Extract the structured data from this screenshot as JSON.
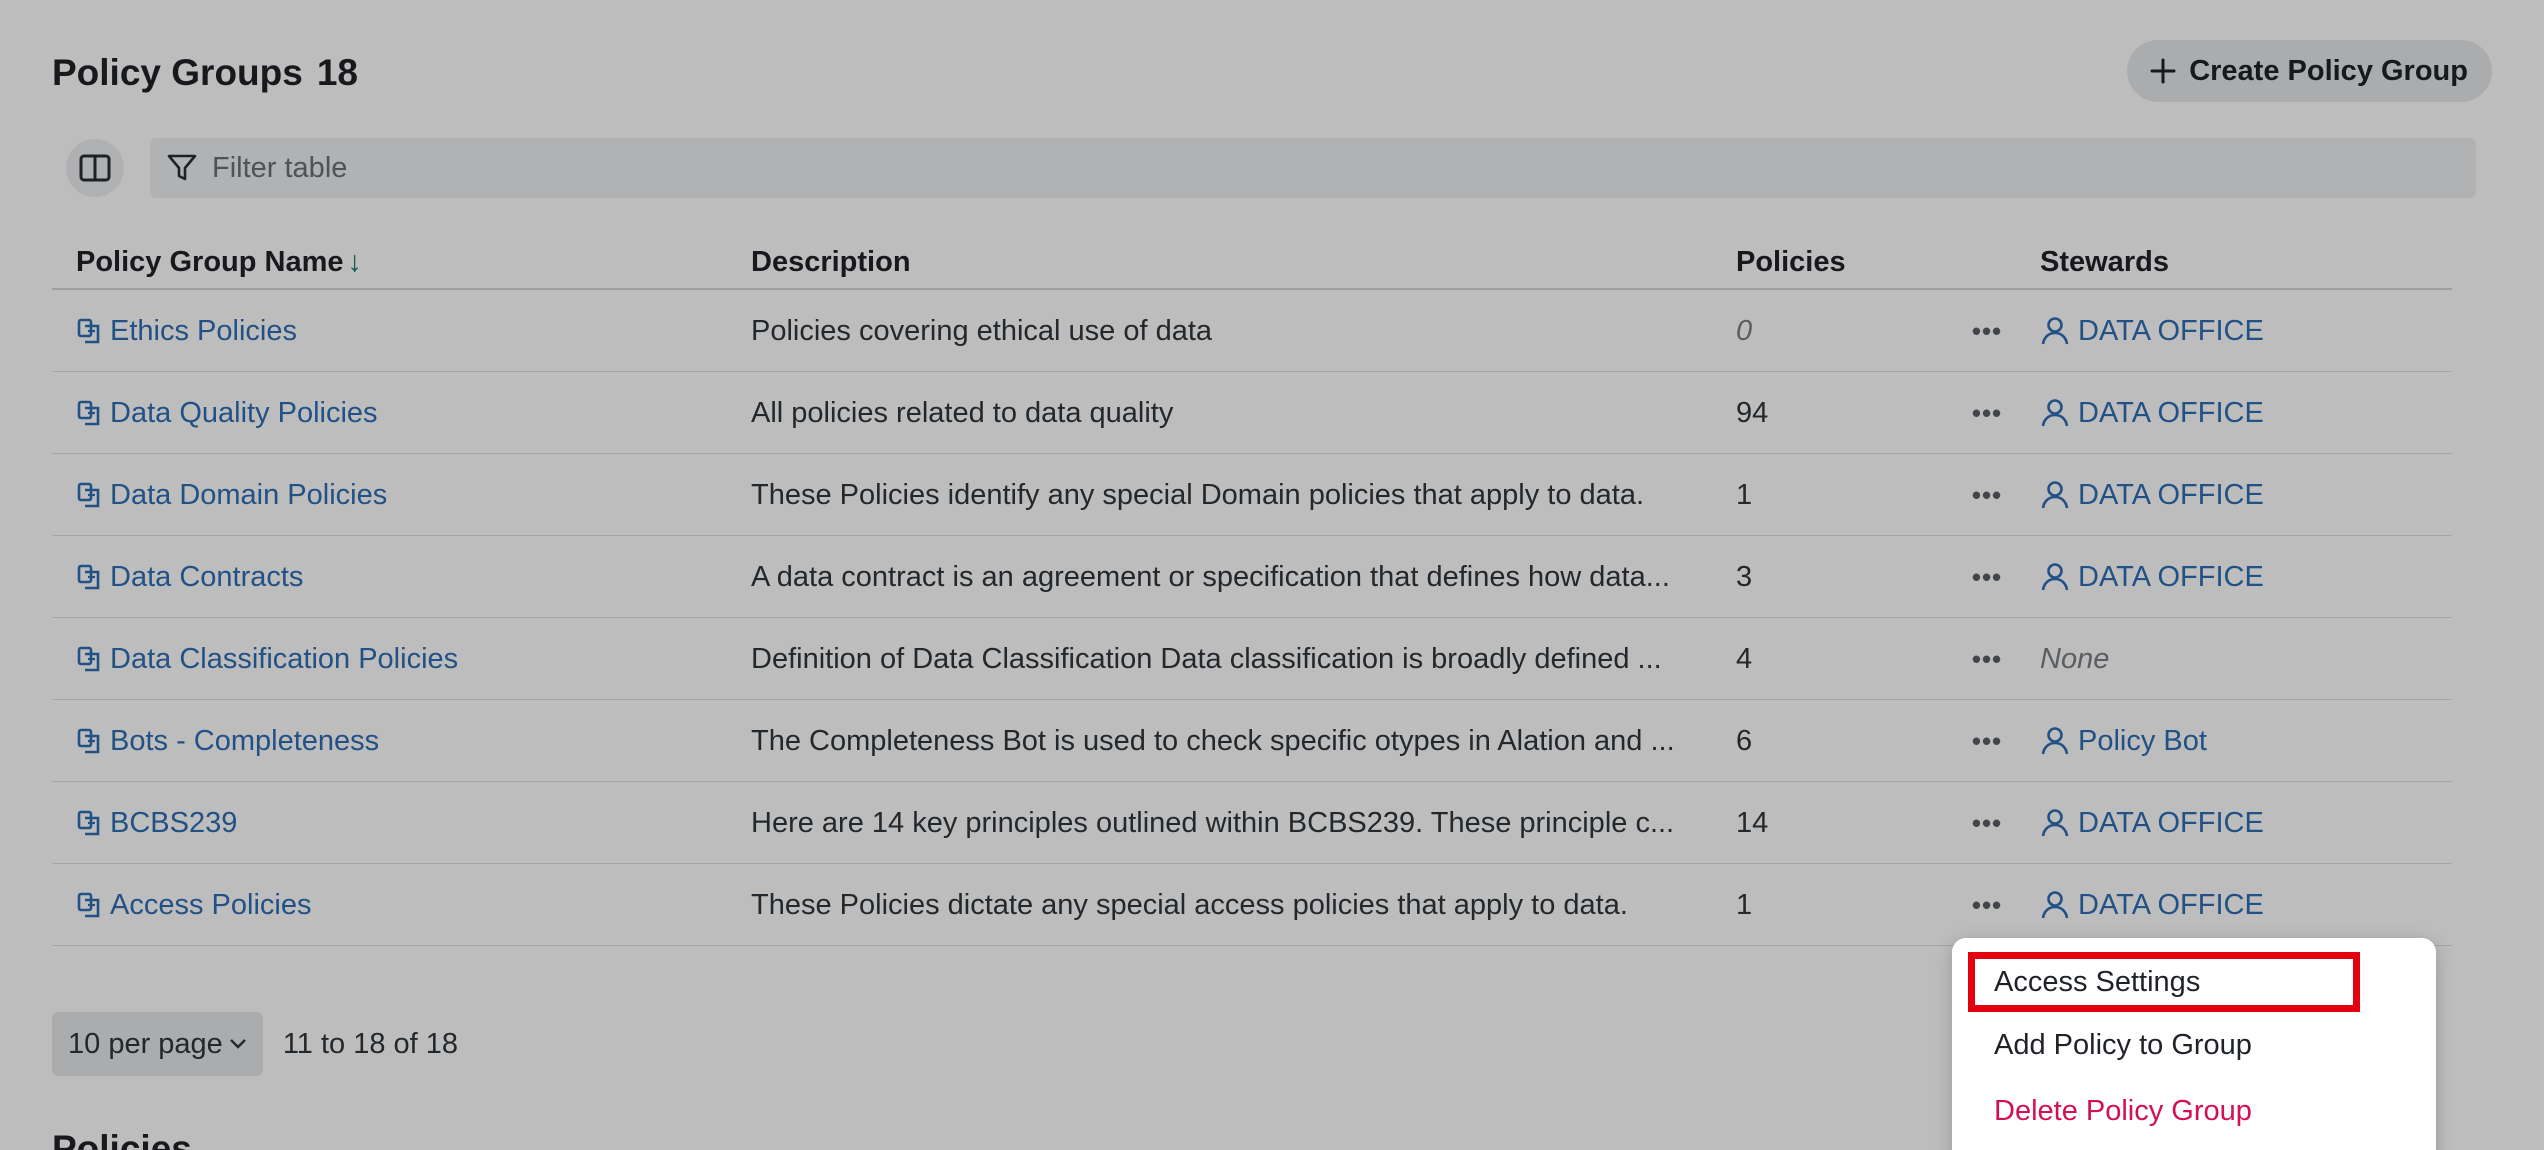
{
  "header": {
    "title": "Policy Groups",
    "count": "18",
    "create_button": "Create Policy Group"
  },
  "toolbar": {
    "filter_placeholder": "Filter table"
  },
  "table": {
    "columns": {
      "name": "Policy Group Name",
      "description": "Description",
      "policies": "Policies",
      "stewards": "Stewards"
    },
    "sort": "descending",
    "rows": [
      {
        "name": "Ethics Policies",
        "description": "Policies covering ethical use of data",
        "policies": "0",
        "steward": "DATA OFFICE"
      },
      {
        "name": "Data Quality Policies",
        "description": "All policies related to data quality",
        "policies": "94",
        "steward": "DATA OFFICE"
      },
      {
        "name": "Data Domain Policies",
        "description": "These Policies identify any special Domain policies that apply to data.",
        "policies": "1",
        "steward": "DATA OFFICE"
      },
      {
        "name": "Data Contracts",
        "description": "A data contract is an agreement or specification that defines how data...",
        "policies": "3",
        "steward": "DATA OFFICE"
      },
      {
        "name": "Data Classification Policies",
        "description": "Definition of Data Classification Data classification is broadly defined ...",
        "policies": "4",
        "steward": "None"
      },
      {
        "name": "Bots - Completeness",
        "description": "The Completeness Bot is used to check specific otypes in Alation and ...",
        "policies": "6",
        "steward": "Policy Bot"
      },
      {
        "name": "BCBS239",
        "description": "Here are 14 key principles outlined within BCBS239. These principle c...",
        "policies": "14",
        "steward": "DATA OFFICE"
      },
      {
        "name": "Access Policies",
        "description": "These Policies dictate any special access policies that apply to data.",
        "policies": "1",
        "steward": "DATA OFFICE"
      }
    ]
  },
  "pagination": {
    "per_page": "10 per page",
    "range": "11 to 18 of 18"
  },
  "next_section_title": "Policies",
  "context_menu": {
    "items": [
      "Access Settings",
      "Add Policy to Group",
      "Delete Policy Group"
    ]
  },
  "colors": {
    "link": "#2f6eb5",
    "sort_arrow": "#0b7a66",
    "danger": "#d4104f",
    "highlight_box": "#e3000f"
  },
  "icons": {
    "create": "plus-icon",
    "columns": "column-layout-icon",
    "filter": "filter-icon",
    "row_type": "policy-group-icon",
    "steward": "user-icon",
    "more": "more-horizontal-icon",
    "dropdown": "chevron-down-icon"
  }
}
